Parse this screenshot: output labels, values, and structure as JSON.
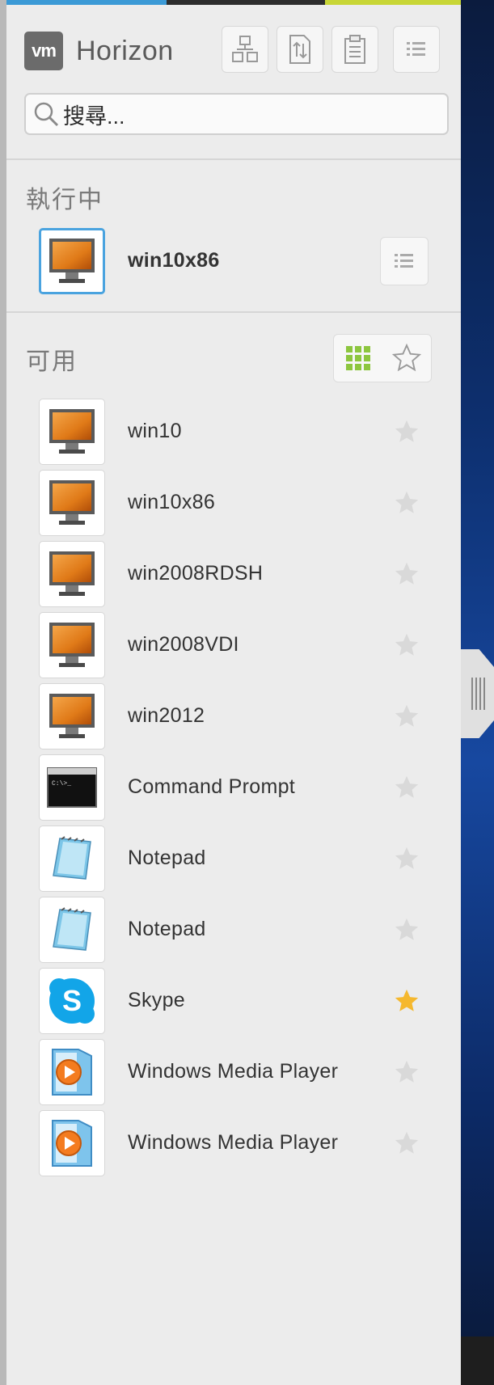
{
  "app": {
    "logo_text": "vm",
    "title": "Horizon"
  },
  "toolbar": {
    "buttons": [
      {
        "name": "connection-server-button",
        "icon": "network-icon"
      },
      {
        "name": "transfer-button",
        "icon": "file-transfer-icon"
      },
      {
        "name": "clipboard-button",
        "icon": "clipboard-icon"
      },
      {
        "name": "menu-button",
        "icon": "list-icon"
      }
    ]
  },
  "search": {
    "placeholder": "搜尋..."
  },
  "running": {
    "title": "執行中",
    "items": [
      {
        "name": "win10x86",
        "icon": "desktop-icon"
      }
    ]
  },
  "available": {
    "title": "可用",
    "view_toggle": {
      "grid": "grid-view-icon",
      "favorites": "star-outline-icon"
    },
    "items": [
      {
        "name": "win10",
        "icon": "desktop-icon",
        "favorite": false
      },
      {
        "name": "win10x86",
        "icon": "desktop-icon",
        "favorite": false
      },
      {
        "name": "win2008RDSH",
        "icon": "desktop-icon",
        "favorite": false
      },
      {
        "name": "win2008VDI",
        "icon": "desktop-icon",
        "favorite": false
      },
      {
        "name": "win2012",
        "icon": "desktop-icon",
        "favorite": false
      },
      {
        "name": "Command Prompt",
        "icon": "cmd-icon",
        "favorite": false
      },
      {
        "name": "Notepad",
        "icon": "notepad-icon",
        "favorite": false
      },
      {
        "name": "Notepad",
        "icon": "notepad-icon",
        "favorite": false
      },
      {
        "name": "Skype",
        "icon": "skype-icon",
        "favorite": true
      },
      {
        "name": "Windows Media Player",
        "icon": "media-player-icon",
        "favorite": false
      },
      {
        "name": "Windows Media Player",
        "icon": "media-player-icon",
        "favorite": false
      }
    ]
  },
  "colors": {
    "accent_blue": "#4aa3df",
    "accent_green": "#8dc63f",
    "star_active": "#f5b82e",
    "star_inactive": "#d9d9d9",
    "top_strip": [
      "#3c9ad6",
      "#2d2d2d",
      "#c8d636"
    ]
  }
}
